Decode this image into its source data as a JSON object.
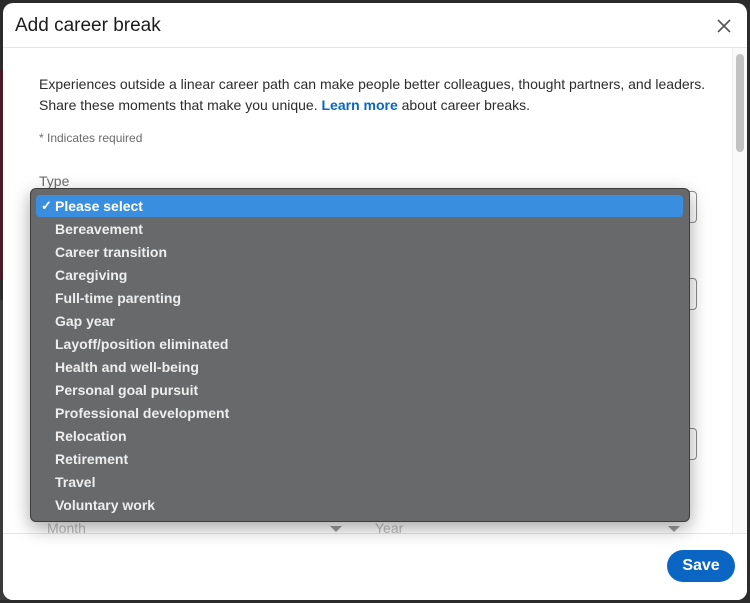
{
  "modal": {
    "title": "Add career break",
    "close_label": "Close"
  },
  "intro": {
    "text_before": "Experiences outside a linear career path can make people better colleagues, thought partners, and leaders. Share these moments that make you unique. ",
    "link": "Learn more",
    "text_after": " about career breaks."
  },
  "required_note": "* Indicates required",
  "type_field": {
    "label": "Type",
    "selected": "Please select",
    "options": [
      "Please select",
      "Bereavement",
      "Career transition",
      "Caregiving",
      "Full-time parenting",
      "Gap year",
      "Layoff/position eliminated",
      "Health and well-being",
      "Personal goal pursuit",
      "Professional development",
      "Relocation",
      "Retirement",
      "Travel",
      "Voluntary work"
    ]
  },
  "date": {
    "month_placeholder": "Month",
    "year_placeholder": "Year"
  },
  "footer": {
    "save_label": "Save"
  },
  "icons": {
    "close": "close-icon",
    "check": "checkmark-icon",
    "caret": "caret-down-icon"
  },
  "colors": {
    "accent": "#0a66c2",
    "selection": "#3a8ee0",
    "dropdown_bg": "#68696b"
  }
}
